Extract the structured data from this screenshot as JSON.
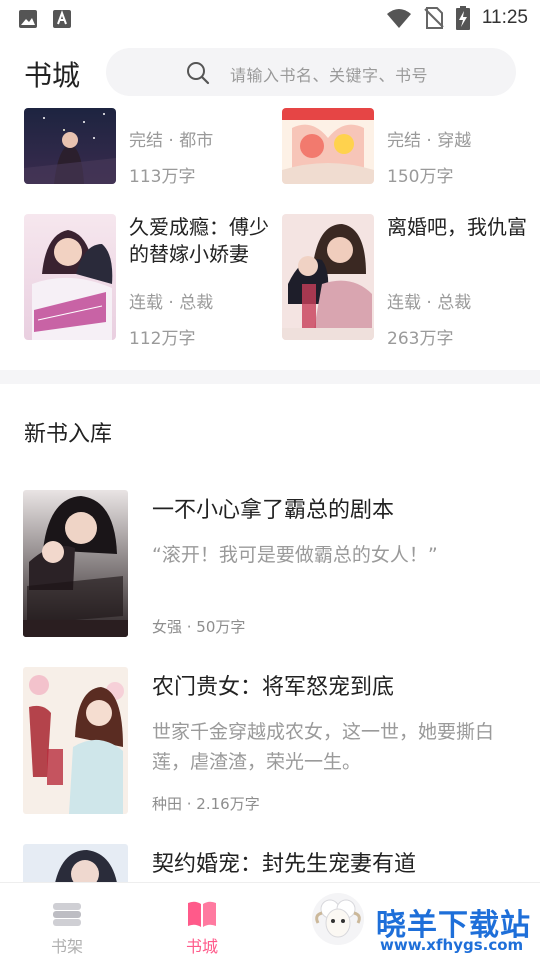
{
  "status_bar": {
    "time": "11:25"
  },
  "header": {
    "title": "书城",
    "search_placeholder": "请输入书名、关键字、书号"
  },
  "grid_books": [
    {
      "meta": "完结 · 都市",
      "count": "113万字"
    },
    {
      "meta": "完结 · 穿越",
      "count": "150万字"
    },
    {
      "title": "久爱成瘾：傅少的替嫁小娇妻",
      "meta": "连载 · 总裁",
      "count": "112万字"
    },
    {
      "title": "离婚吧，我仇富",
      "meta": "连载 · 总裁",
      "count": "263万字"
    }
  ],
  "new_books": {
    "section_title": "新书入库",
    "items": [
      {
        "title": "一不小心拿了霸总的剧本",
        "desc": "“滚开！我可是要做霸总的女人！”",
        "meta": "女强 · 50万字"
      },
      {
        "title": "农门贵女：将军怒宠到底",
        "desc": "世家千金穿越成农女，这一世，她要撕白莲，虐渣渣，荣光一生。",
        "meta": "种田 · 2.16万字"
      },
      {
        "title": "契约婚宠：封先生宠妻有道",
        "desc": "",
        "meta": ""
      }
    ]
  },
  "bottom_nav": [
    {
      "label": "书架",
      "icon": "bookshelf-icon",
      "active": false
    },
    {
      "label": "书城",
      "icon": "book-store-icon",
      "active": true
    },
    {
      "label": "",
      "icon": "sheep-icon",
      "active": false
    }
  ],
  "watermark": {
    "text": "晓羊下载站",
    "url": "www.xfhygs.com"
  },
  "colors": {
    "accent": "#ff5a8a",
    "muted": "#9a9a9a",
    "watermark": "#1e6fd9"
  }
}
